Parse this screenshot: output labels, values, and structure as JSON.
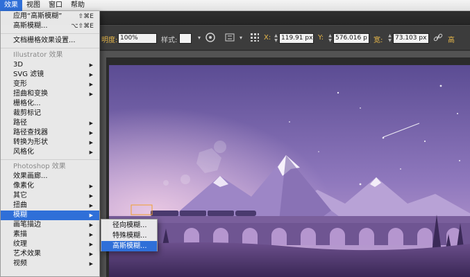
{
  "menubar": {
    "items": [
      {
        "label": "效果",
        "active": true
      },
      {
        "label": "视图",
        "active": false
      },
      {
        "label": "窗口",
        "active": false
      },
      {
        "label": "帮助",
        "active": false
      }
    ]
  },
  "controlbar": {
    "opacity_label": "明度:",
    "opacity_value": "100%",
    "style_label": "样式:",
    "x_label": "X:",
    "x_value": "119.91 px",
    "y_label": "Y:",
    "y_value": "576.016 p",
    "width_label": "宽:",
    "width_value": "73.103 px"
  },
  "effect_menu": {
    "apply_last": "应用“高斯模糊”",
    "apply_last_shortcut": "⇧⌘E",
    "last_effect": "高斯模糊...",
    "last_effect_shortcut": "⌥⇧⌘E",
    "doc_raster_settings": "文档栅格效果设置...",
    "illustrator_header": "Illustrator 效果",
    "illustrator_items": [
      "3D",
      "SVG 滤镜",
      "变形",
      "扭曲和变换",
      "栅格化...",
      "裁剪标记",
      "路径",
      "路径查找器",
      "转换为形状",
      "风格化"
    ],
    "photoshop_header": "Photoshop 效果",
    "photoshop_items": [
      "效果画廊...",
      "像素化",
      "其它",
      "扭曲",
      "模糊",
      "画笔描边",
      "素描",
      "纹理",
      "艺术效果",
      "视频"
    ]
  },
  "blur_submenu": {
    "items": [
      "径向模糊...",
      "特殊模糊...",
      "高斯模糊..."
    ]
  },
  "colors": {
    "highlight": "#2f6fd8",
    "sky_top": "#6b5a9e",
    "sky_bottom": "#c9a9d8"
  }
}
